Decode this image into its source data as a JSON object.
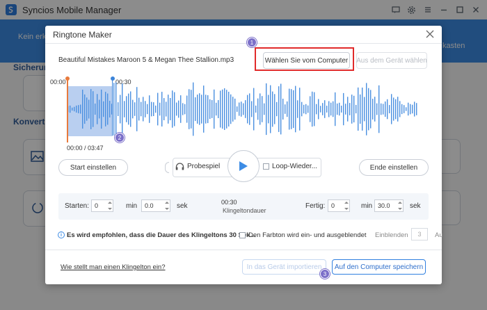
{
  "app": {
    "title": "Syncios Mobile Manager",
    "bg_left_text": "Kein erkan",
    "bg_right_text": "kasten",
    "bg_heading_1": "Sicherung",
    "bg_heading_2": "Konvertie"
  },
  "dialog": {
    "title": "Ringtone Maker",
    "file_name": "Beautiful Mistakes Maroon 5 & Megan Thee Stallion.mp3",
    "btn_from_computer": "Wählen Sie vom Computer",
    "btn_from_device": "Aus dem Gerät wählen",
    "badges": [
      "1",
      "2",
      "3"
    ],
    "sel_start_label": "00:00",
    "sel_end_label": "00:30",
    "position_time": "00:00 / 03:47",
    "btn_start_set": "Start einstellen",
    "btn_end_set": "Ende einstellen",
    "probe_label": "Probespiel",
    "loop_label": "Loop-Wieder...",
    "start_label": "Starten:",
    "start_min": "0",
    "min_unit": "min",
    "start_sec": "0.0",
    "sec_unit": "sek",
    "duration_value": "00:30",
    "duration_label": "Klingeltondauer",
    "end_label": "Fertig:",
    "end_min": "0",
    "end_sec": "30.0",
    "info_text": "Es wird empfohlen, dass die Dauer des Klingeltons 30 Sek...",
    "fade_text": "Den Farbton wird ein- und ausgeblendet",
    "fade_in_label": "Einblenden",
    "fade_in_value": "3",
    "fade_out_frag": "Au",
    "help_link": "Wie stellt man einen Klingelton ein?",
    "btn_import": "In das Gerät importieren",
    "btn_save": "Auf den Computer speichern",
    "selection_start_fraction": 0,
    "selection_end_fraction": 0.132
  },
  "colors": {
    "accent_blue": "#3d8ce5",
    "wave_blue": "#4a8fe0",
    "selection_fill": "#a7c3ec",
    "highlight_red": "#e12a2a",
    "badge_purple": "#7b6fc9",
    "start_marker": "#e87a3c"
  }
}
